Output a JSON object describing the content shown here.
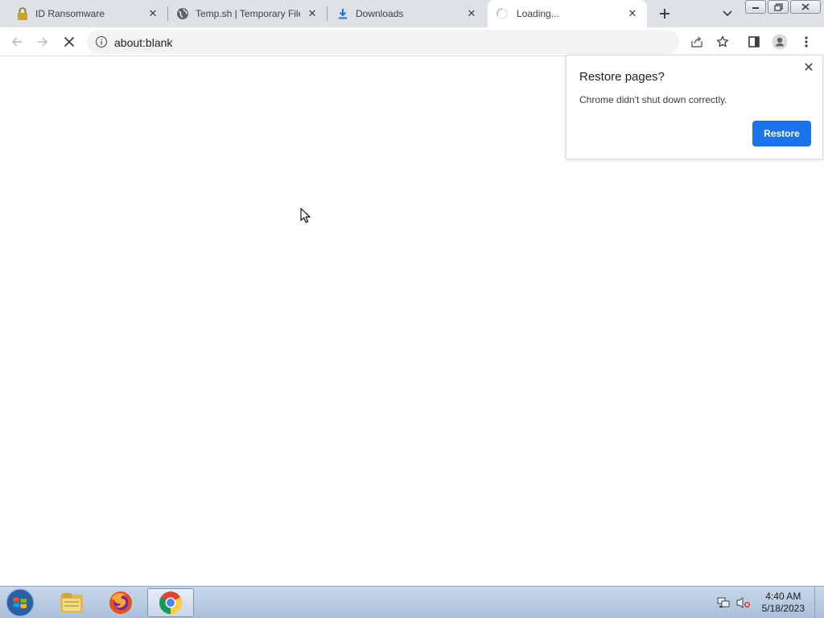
{
  "browser": {
    "tabs": [
      {
        "title": "ID Ransomware",
        "icon": "lock-icon",
        "active": false
      },
      {
        "title": "Temp.sh | Temporary File",
        "icon": "globe-icon",
        "active": false
      },
      {
        "title": "Downloads",
        "icon": "download-icon",
        "active": false
      },
      {
        "title": "Loading...",
        "icon": "loading-spinner-icon",
        "active": true
      }
    ],
    "close_glyph": "✕",
    "address_bar": {
      "url": "about:blank"
    }
  },
  "restore_dialog": {
    "title": "Restore pages?",
    "message": "Chrome didn't shut down correctly.",
    "restore_button": "Restore",
    "close_glyph": "✕"
  },
  "taskbar": {
    "apps": [
      {
        "name": "File Explorer",
        "icon": "file-explorer-icon",
        "active": false
      },
      {
        "name": "Firefox",
        "icon": "firefox-icon",
        "active": false
      },
      {
        "name": "Google Chrome",
        "icon": "chrome-icon",
        "active": true
      }
    ],
    "clock": {
      "time": "4:40 AM",
      "date": "5/18/2023"
    }
  },
  "colors": {
    "tabstrip": "#dee1e6",
    "accent": "#1a73e8",
    "taskbar": "#b6c9e0"
  }
}
